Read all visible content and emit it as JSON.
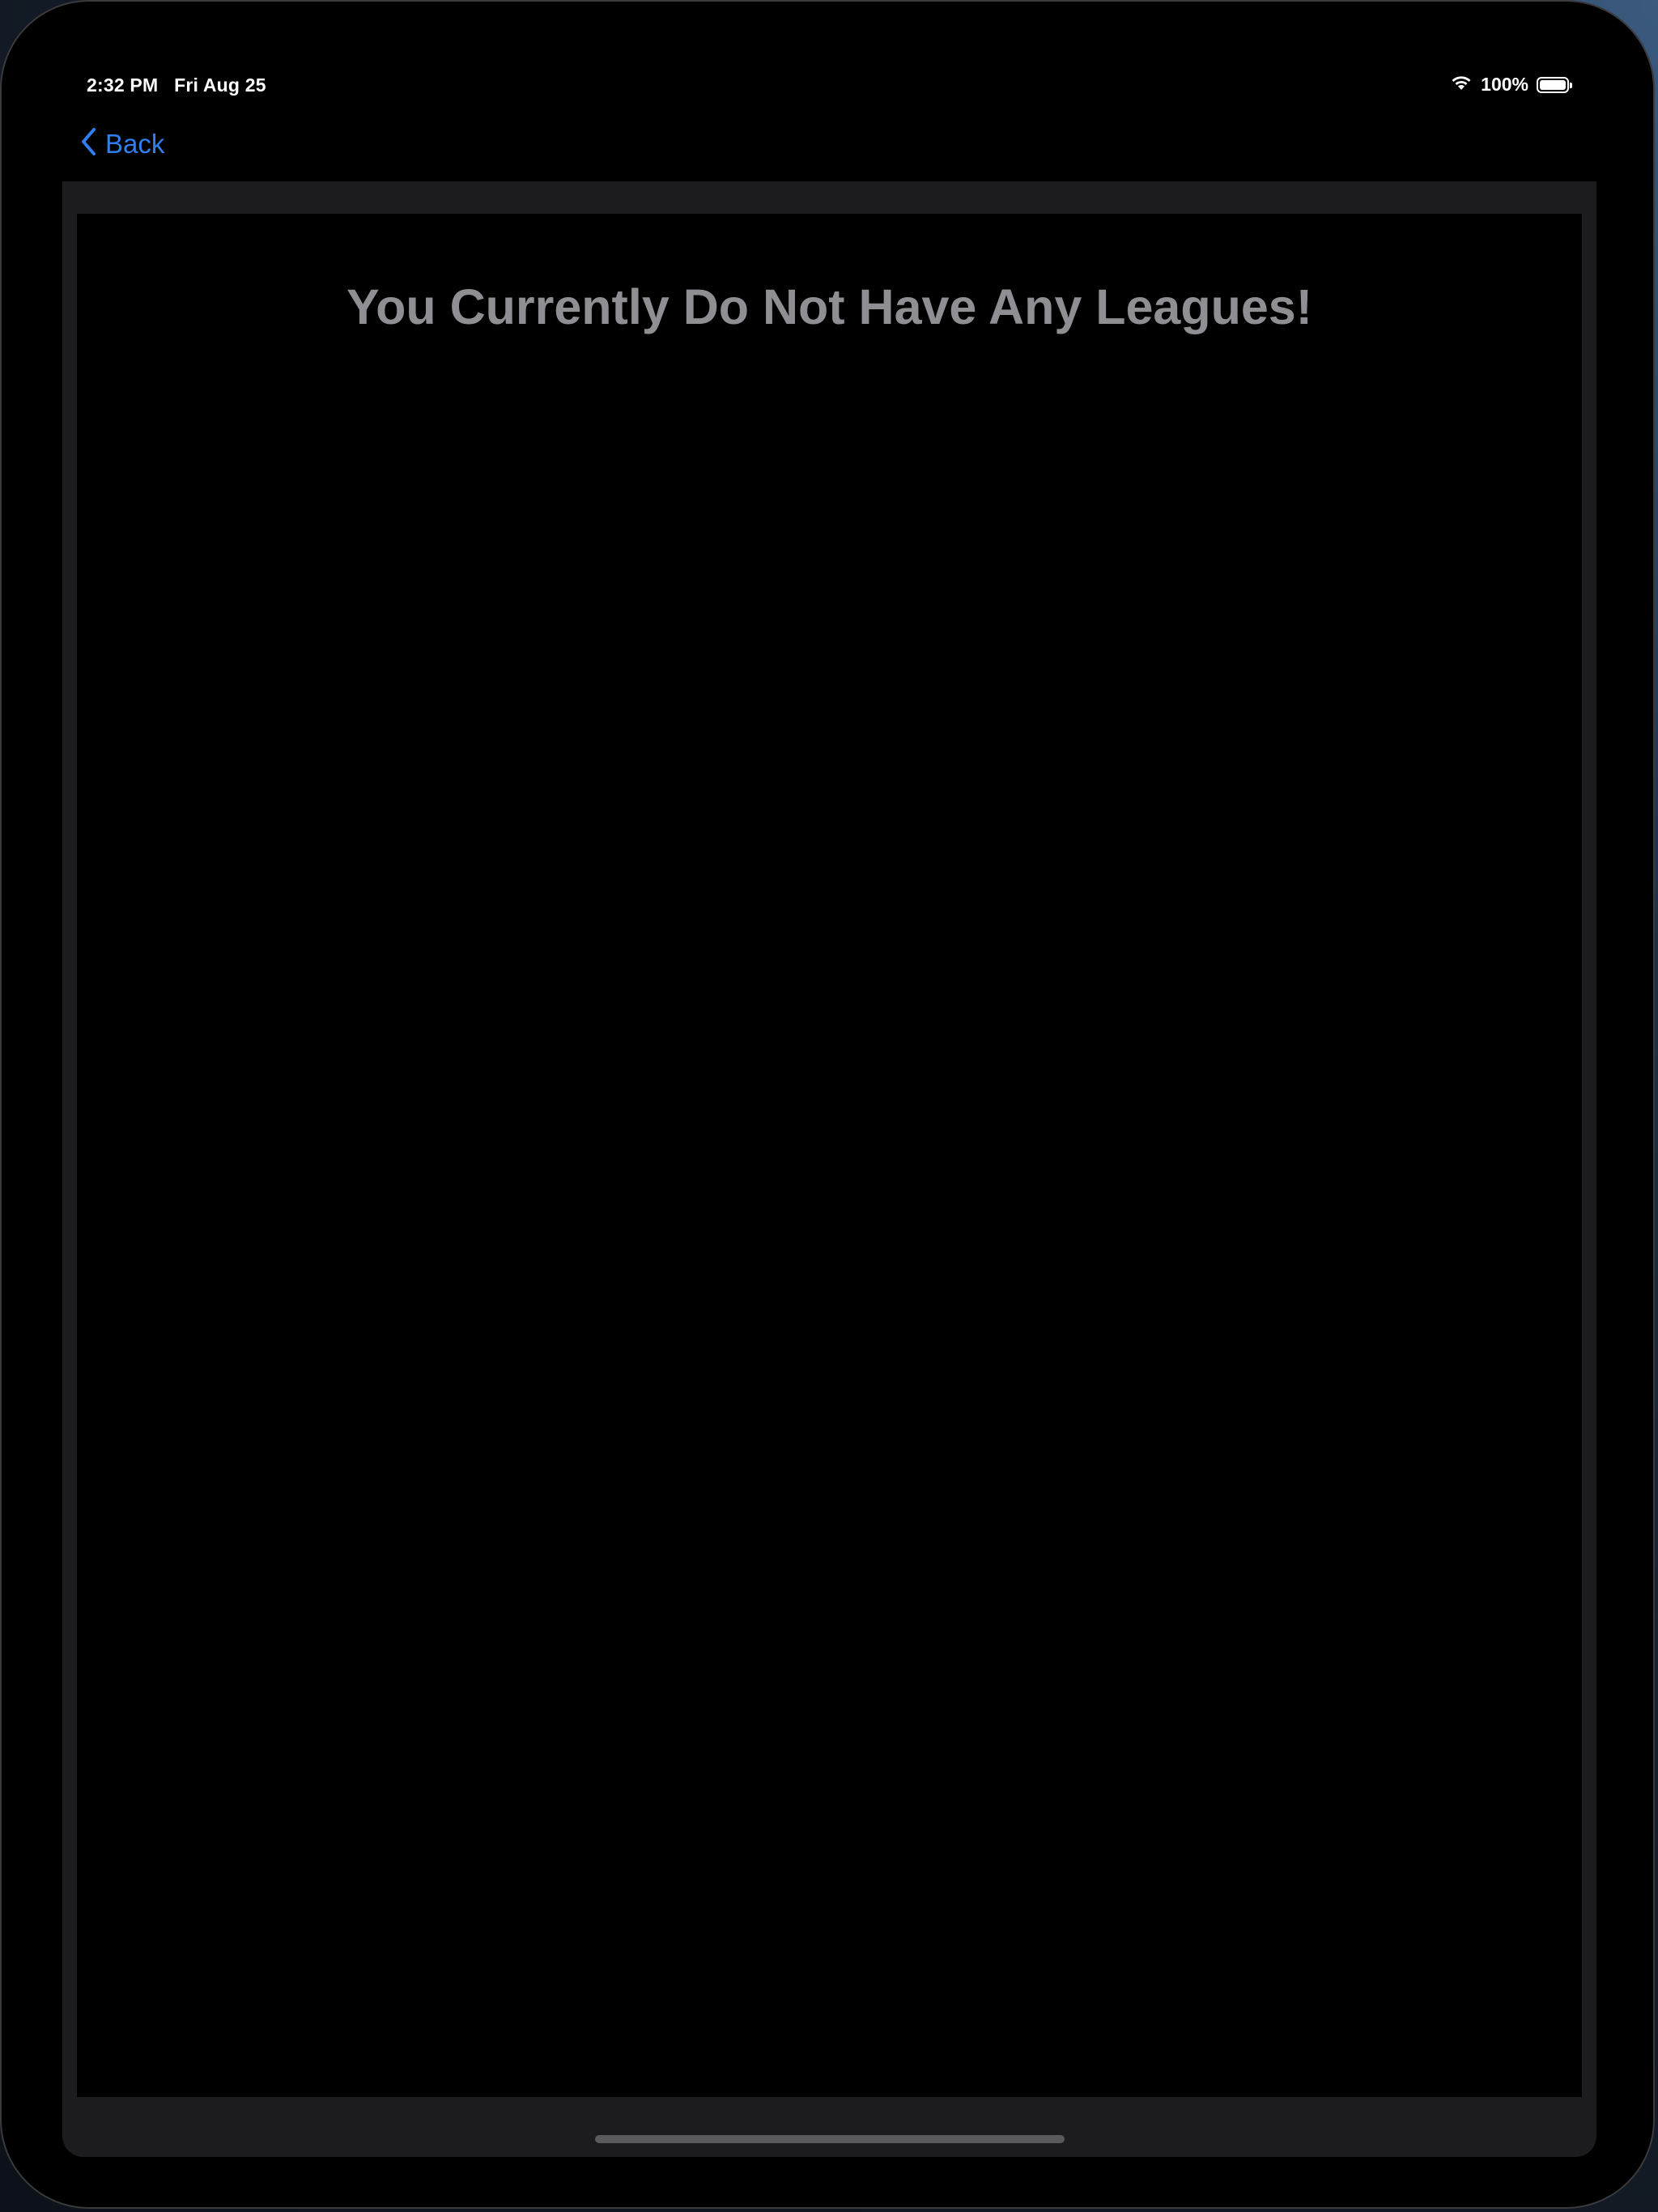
{
  "status_bar": {
    "time": "2:32 PM   Fri Aug 25",
    "battery_percent": "100%",
    "battery_level": 1.0,
    "icons": [
      "wifi-icon",
      "battery-icon"
    ]
  },
  "nav": {
    "back_label": "Back",
    "back_icon": "chevron-left-icon"
  },
  "main": {
    "empty_message": "You Currently Do Not Have Any Leagues!"
  },
  "colors": {
    "accent": "#2f7ff0",
    "background": "#000000",
    "sheet": "#1c1c1e",
    "message_text": "#8e8e93"
  }
}
